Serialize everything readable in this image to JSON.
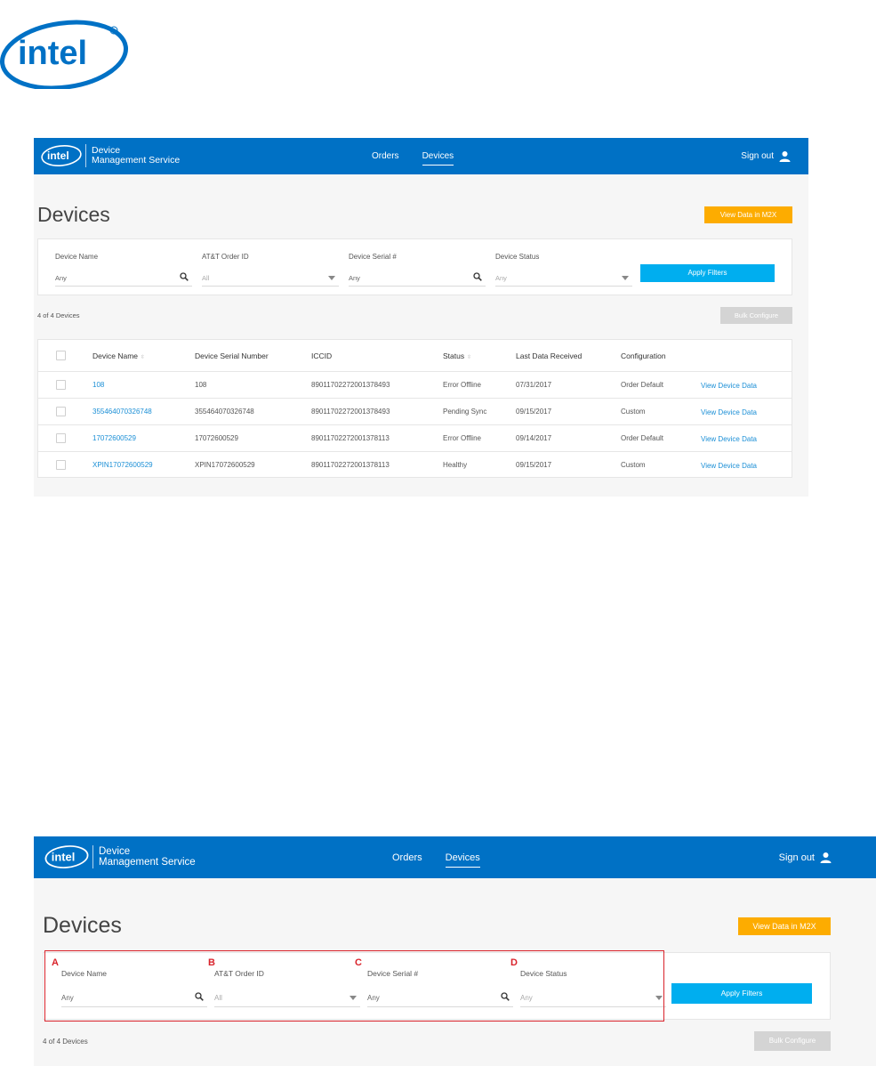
{
  "brand": {
    "logo_text": "intel",
    "app_line1": "Device",
    "app_line2": "Management Service"
  },
  "nav": {
    "orders": "Orders",
    "devices": "Devices",
    "active": "Devices"
  },
  "header": {
    "signout": "Sign out"
  },
  "page": {
    "title": "Devices",
    "view_m2x_label": "View Data in M2X",
    "apply_filters_label": "Apply Filters",
    "bulk_configure_label": "Bulk Configure",
    "count_text": "4 of 4 Devices"
  },
  "filters": [
    {
      "label": "Device Name",
      "value": "Any",
      "type": "search"
    },
    {
      "label": "AT&T Order ID",
      "value": "All",
      "type": "select"
    },
    {
      "label": "Device Serial #",
      "value": "Any",
      "type": "search"
    },
    {
      "label": "Device Status",
      "value": "Any",
      "type": "select"
    }
  ],
  "table": {
    "headers": [
      "Device Name",
      "Device Serial Number",
      "ICCID",
      "Status",
      "Last Data Received",
      "Configuration"
    ],
    "rows": [
      {
        "name": "108",
        "serial": "108",
        "iccid": "89011702272001378493",
        "status": "Error Offline",
        "last": "07/31/2017",
        "config": "Order Default",
        "action": "View Device Data"
      },
      {
        "name": "355464070326748",
        "serial": "355464070326748",
        "iccid": "89011702272001378493",
        "status": "Pending Sync",
        "last": "09/15/2017",
        "config": "Custom",
        "action": "View Device Data"
      },
      {
        "name": "17072600529",
        "serial": "17072600529",
        "iccid": "89011702272001378113",
        "status": "Error Offline",
        "last": "09/14/2017",
        "config": "Order Default",
        "action": "View Device Data"
      },
      {
        "name": "XPIN17072600529",
        "serial": "XPIN17072600529",
        "iccid": "89011702272001378113",
        "status": "Healthy",
        "last": "09/15/2017",
        "config": "Custom",
        "action": "View Device Data"
      }
    ]
  },
  "annotations": {
    "box_color": "#d9232b",
    "letters": [
      "A",
      "B",
      "C",
      "D"
    ]
  },
  "colors": {
    "topbar": "#0071c5",
    "m2x": "#fdac00",
    "apply": "#00aeef",
    "bulk_disabled": "#d4d4d4",
    "link": "#1b8fd6"
  }
}
